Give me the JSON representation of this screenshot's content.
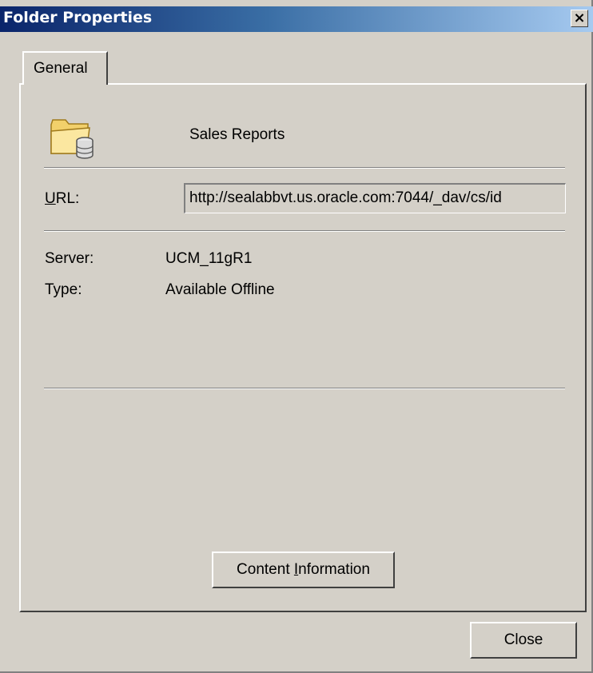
{
  "window": {
    "title": "Folder Properties",
    "close_glyph": "×"
  },
  "tabs": [
    {
      "label": "General",
      "selected": true
    }
  ],
  "folder": {
    "icon": "folder-database-icon",
    "name": "Sales Reports"
  },
  "url": {
    "label_mnemonic": "U",
    "label_rest": "RL:",
    "value": "http://sealabbvt.us.oracle.com:7044/_dav/cs/id"
  },
  "properties": [
    {
      "label": "Server:",
      "value": "UCM_11gR1"
    },
    {
      "label": "Type:",
      "value": "Available Offline"
    }
  ],
  "buttons": {
    "content_info_pre": "Content ",
    "content_info_mnemonic": "I",
    "content_info_post": "nformation",
    "close": "Close"
  },
  "colors": {
    "dialog_bg": "#d4d0c8",
    "title_gradient_start": "#0a246a",
    "title_gradient_end": "#a6caf0"
  }
}
